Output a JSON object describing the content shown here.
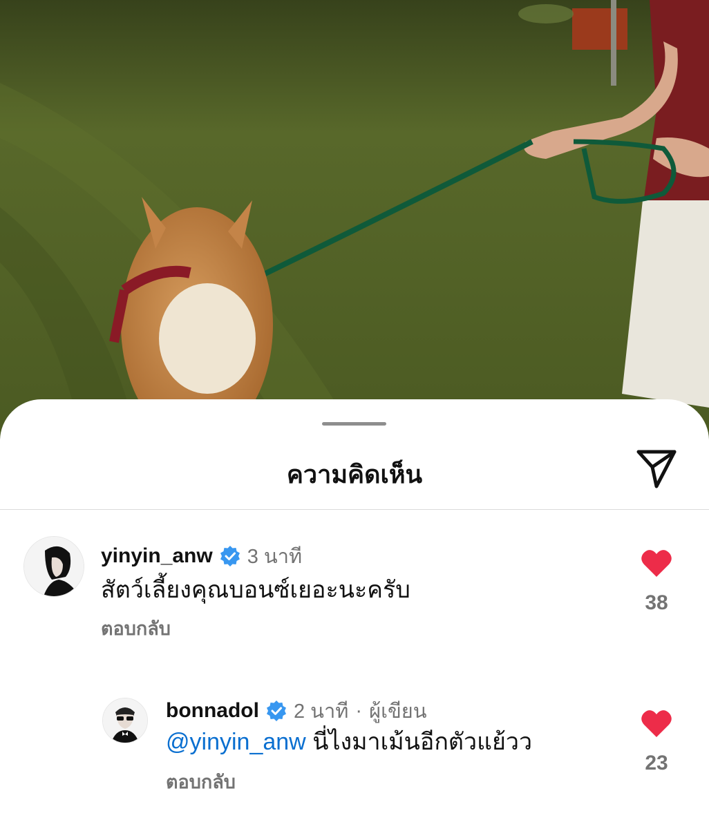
{
  "sheet": {
    "title": "ความคิดเห็น"
  },
  "icons": {
    "share": "paper-plane-icon",
    "verified": "verified-badge-icon",
    "heart": "heart-filled-icon"
  },
  "colors": {
    "heart": "#ed2c49",
    "verified": "#3897f0",
    "mention": "#0a6fd0",
    "secondary_text": "#737373"
  },
  "comments": [
    {
      "username": "yinyin_anw",
      "time": "3 นาที",
      "text": "สัตว์เลี้ยงคุณบอนซ์เยอะนะครับ",
      "reply_label": "ตอบกลับ",
      "likes": "38",
      "liked": true
    },
    {
      "username": "bonnadol",
      "time": "2 นาที",
      "separator": "·",
      "role": "ผู้เขียน",
      "mention": "@yinyin_anw",
      "text": "นี่ไงมาเม้นอีกตัวแย้วว",
      "reply_label": "ตอบกลับ",
      "likes": "23",
      "liked": true
    }
  ]
}
